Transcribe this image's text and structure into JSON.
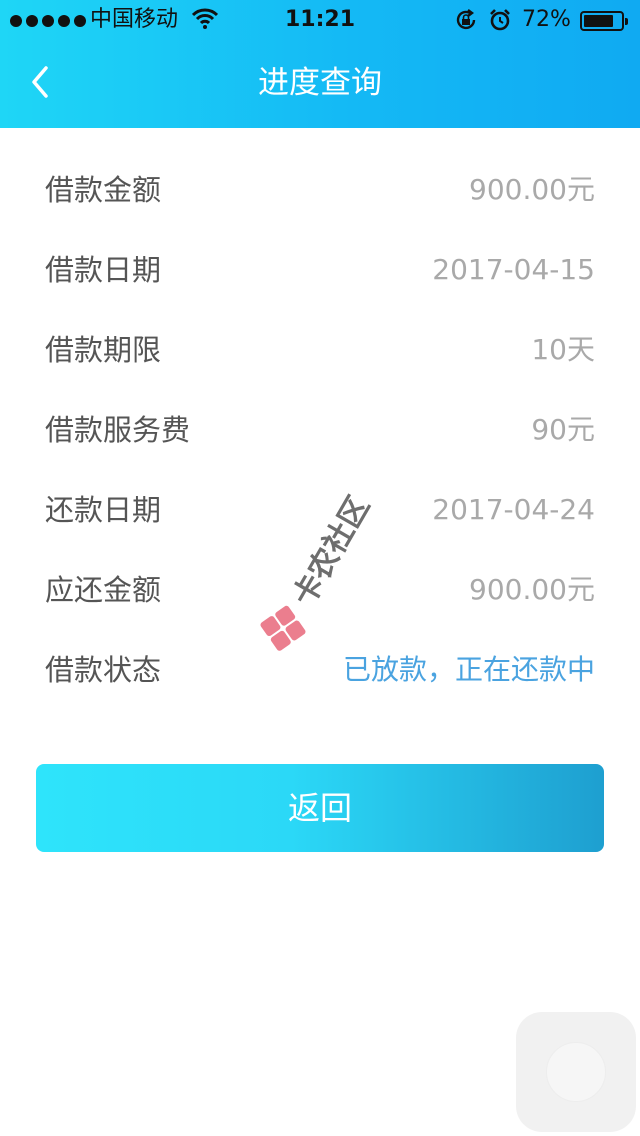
{
  "status_bar": {
    "carrier": "中国移动",
    "time": "11:21",
    "battery_percent": "72%",
    "battery_level": 0.72,
    "icons": [
      "signal-dots-icon",
      "wifi-icon",
      "rotation-lock-icon",
      "alarm-icon",
      "battery-icon"
    ]
  },
  "header": {
    "title": "进度查询",
    "back_icon": "chevron-left-icon",
    "gradient": [
      "#1fd6f6",
      "#10aaf2"
    ]
  },
  "details": [
    {
      "label": "借款金额",
      "value": "900.00元"
    },
    {
      "label": "借款日期",
      "value": "2017-04-15"
    },
    {
      "label": "借款期限",
      "value": "10天"
    },
    {
      "label": "借款服务费",
      "value": "90元"
    },
    {
      "label": "还款日期",
      "value": "2017-04-24"
    },
    {
      "label": "应还金额",
      "value": "900.00元"
    },
    {
      "label": "借款状态",
      "value": "已放款，正在还款中"
    }
  ],
  "return_button": {
    "label": "返回"
  },
  "watermark": {
    "text": "卡农社区"
  },
  "colors": {
    "accent": "#4aa3e0",
    "label": "#555555",
    "value": "#a9a9a9"
  }
}
